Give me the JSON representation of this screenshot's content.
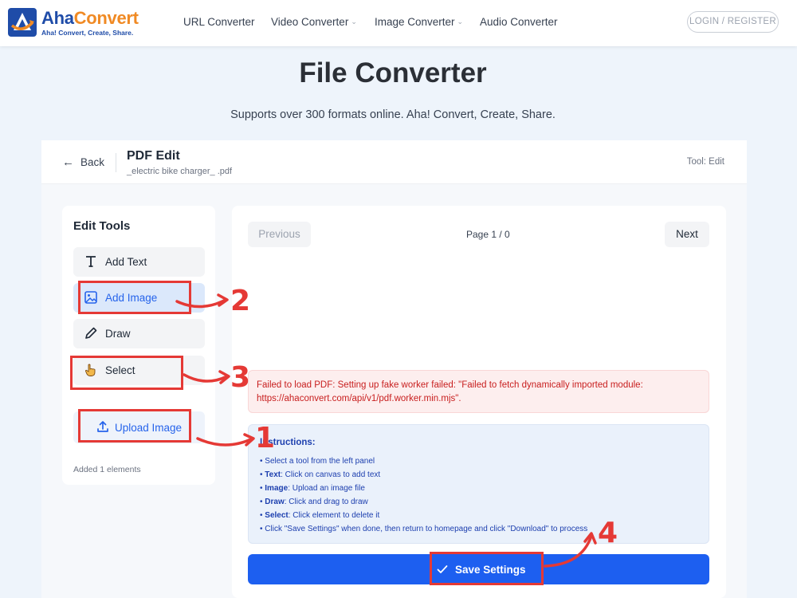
{
  "header": {
    "brand_part1": "Aha",
    "brand_part2": "Convert",
    "tagline": "Aha! Convert, Create, Share.",
    "nav": [
      {
        "label": "URL Converter"
      },
      {
        "label": "Video Converter"
      },
      {
        "label": "Image Converter"
      },
      {
        "label": "Audio Converter"
      }
    ],
    "login_label": "LOGIN / REGISTER"
  },
  "hero": {
    "title": "File Converter",
    "subtitle": "Supports over 300 formats online. Aha! Convert, Create, Share."
  },
  "editor": {
    "back_label": "Back",
    "title": "PDF Edit",
    "filename": "_electric bike charger_ .pdf",
    "tool_status": "Tool: Edit"
  },
  "tools": {
    "heading": "Edit Tools",
    "items": [
      {
        "label": "Add Text",
        "icon": "text-icon"
      },
      {
        "label": "Add Image",
        "icon": "image-icon"
      },
      {
        "label": "Draw",
        "icon": "pencil-icon"
      },
      {
        "label": "Select",
        "icon": "hand-pointer-icon"
      }
    ],
    "upload_label": "Upload Image",
    "added_count": "Added 1 elements"
  },
  "pager": {
    "prev_label": "Previous",
    "next_label": "Next",
    "indicator": "Page 1 / 0"
  },
  "error_message": "Failed to load PDF: Setting up fake worker failed: \"Failed to fetch dynamically imported module: https://ahaconvert.com/api/v1/pdf.worker.min.mjs\".",
  "instructions": {
    "title": "Instructions:",
    "items": [
      {
        "key": "",
        "text": "Select a tool from the left panel"
      },
      {
        "key": "Text",
        "text": ": Click on canvas to add text"
      },
      {
        "key": "Image",
        "text": ": Upload an image file"
      },
      {
        "key": "Draw",
        "text": ": Click and drag to draw"
      },
      {
        "key": "Select",
        "text": ": Click element to delete it"
      },
      {
        "key": "",
        "text": "Click \"Save Settings\" when done, then return to homepage and click \"Download\" to process"
      }
    ]
  },
  "save_label": "Save Settings",
  "annotations": {
    "step1": "1",
    "step2": "2",
    "step3": "3",
    "step4": "4"
  },
  "colors": {
    "brand_blue": "#1f4ca8",
    "brand_orange": "#f08a24",
    "primary": "#1d5ff0",
    "error": "#c81e1e",
    "annotation_red": "#e53935"
  }
}
